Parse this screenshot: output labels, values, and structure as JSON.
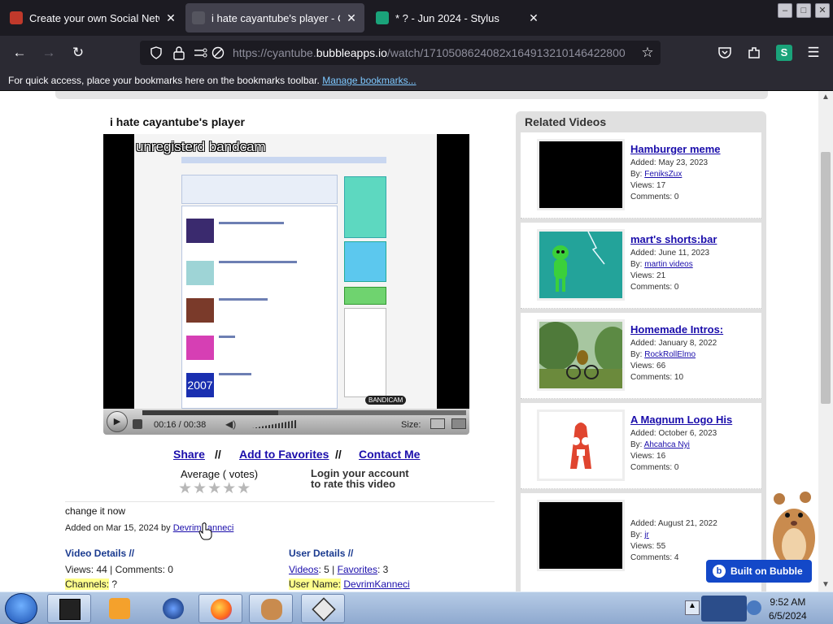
{
  "browser": {
    "tabs": [
      {
        "title": "Create your own Social Network",
        "favicon_color": "#c0392b",
        "active": false
      },
      {
        "title": "i hate cayantube's player - Cyan",
        "favicon_color": "#333333",
        "active": true
      },
      {
        "title": "* ? - Jun 2024 - Stylus",
        "favicon_color": "#1aa37a",
        "active": false
      }
    ],
    "url_host": "https://cyantube.",
    "url_domain": "bubbleapps.io",
    "url_path": "/watch/1710508624082x164913210146422800",
    "bookmarks_text": "For quick access, place your bookmarks here on the bookmarks toolbar.",
    "bookmarks_link": "Manage bookmarks..."
  },
  "video": {
    "title": "i hate cayantube's player",
    "watermark": "unregisterd bandcam",
    "bandicam_badge": "BANDICAM",
    "screen_date": "2007",
    "current_time": "00:16",
    "duration": "00:38",
    "progress_fraction": 0.42,
    "size_label": "Size:"
  },
  "actions": {
    "share": "Share",
    "add_favorites": "Add to Favorites",
    "contact": "Contact Me",
    "separator": "//"
  },
  "rating": {
    "label": "Average ( votes)",
    "stars": "★★★★★",
    "login_line1": "Login your account",
    "login_line2": "to rate this video"
  },
  "details": {
    "description": "change it now",
    "added_prefix": "Added on Mar 15, 2024 by ",
    "added_by": "DevrimKanneci",
    "video_details_title": "Video Details //",
    "views_comments": "Views: 44 | Comments: 0",
    "channels_label": "Channels:",
    "channels_value": " ?",
    "user_details_title": "User Details //",
    "videos_label": "Videos",
    "videos_count": ": 5 | ",
    "favorites_label": "Favorites",
    "favorites_count": ": 3",
    "username_label": "User Name:",
    "username_value": "DevrimKanneci"
  },
  "related": {
    "title": "Related Videos",
    "items": [
      {
        "title": "Hamburger meme ",
        "added": "Added: May 23, 2023",
        "by_label": "By: ",
        "by": "FeniksZux",
        "views": "Views: 17",
        "comments": "Comments: 0",
        "thumb": "black"
      },
      {
        "title": "mart's shorts:bar",
        "added": "Added: June 11, 2023",
        "by_label": "By: ",
        "by": "martin videos",
        "views": "Views: 21",
        "comments": "Comments: 0",
        "thumb": "green-alien"
      },
      {
        "title": "Homemade Intros: ",
        "added": "Added: January 8, 2022",
        "by_label": "By: ",
        "by": "RockRollElmo",
        "views": "Views: 66",
        "comments": "Comments: 10",
        "thumb": "bike-scene"
      },
      {
        "title": "A Magnum Logo His",
        "added": "Added: October 6, 2023",
        "by_label": "By: ",
        "by": "Ahcahca Nyi",
        "views": "Views: 16",
        "comments": "Comments: 0",
        "thumb": "red-letter"
      },
      {
        "title": "",
        "added": "Added: August 21, 2022",
        "by_label": "By: ",
        "by": "jr",
        "views": "Views: 55",
        "comments": "Comments: 4",
        "thumb": "black"
      }
    ]
  },
  "badge": {
    "built_on": "Built on Bubble",
    "logo": "b"
  },
  "taskbar": {
    "time": "9:52 AM",
    "date": "6/5/2024",
    "apps": [
      "terminal-app",
      "media-player-app",
      "browser-globe-app",
      "firefox-app",
      "hamster-app",
      "unity-app"
    ]
  },
  "icons": {
    "back": "←",
    "forward": "→",
    "reload": "↻",
    "star": "☆",
    "menu": "☰",
    "close": "✕"
  },
  "colors": {
    "link": "#1a0dab",
    "accent_blue": "#1348c8",
    "highlight": "#ffff8c"
  }
}
